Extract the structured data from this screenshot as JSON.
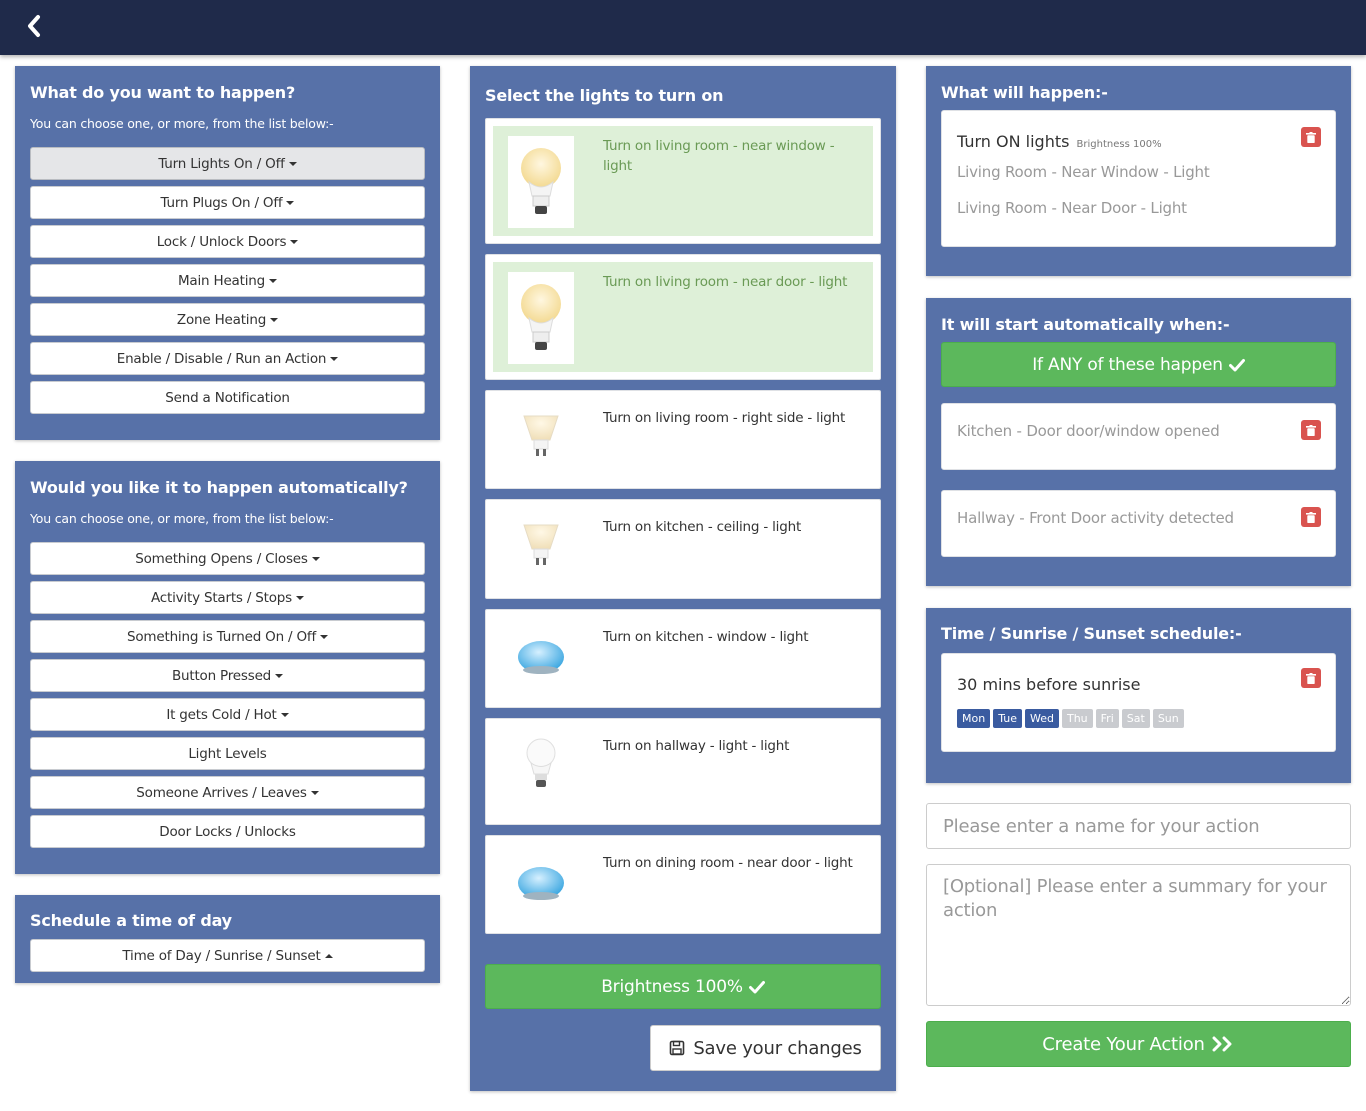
{
  "left": {
    "what": {
      "title": "What do you want to happen?",
      "subtitle": "You can choose one, or more, from the list below:-",
      "items": [
        {
          "label": "Turn Lights On / Off"
        },
        {
          "label": "Turn Plugs On / Off"
        },
        {
          "label": "Lock / Unlock Doors"
        },
        {
          "label": "Main Heating"
        },
        {
          "label": "Zone Heating"
        },
        {
          "label": "Enable / Disable / Run an Action"
        },
        {
          "label": "Send a Notification"
        }
      ]
    },
    "auto": {
      "title": "Would you like it to happen automatically?",
      "subtitle": "You can choose one, or more, from the list below:-",
      "items": [
        {
          "label": "Something Opens / Closes"
        },
        {
          "label": "Activity Starts / Stops"
        },
        {
          "label": "Something is Turned On / Off"
        },
        {
          "label": "Button Pressed"
        },
        {
          "label": "It gets Cold / Hot"
        },
        {
          "label": "Light Levels"
        },
        {
          "label": "Someone Arrives / Leaves"
        },
        {
          "label": "Door Locks / Unlocks"
        }
      ]
    },
    "schedule": {
      "title": "Schedule a time of day",
      "items": [
        {
          "label": "Time of Day / Sunrise / Sunset"
        }
      ]
    }
  },
  "middle": {
    "title": "Select the lights to turn on",
    "lights": [
      {
        "label": "Turn on living room - near window - light",
        "selected": true,
        "icon": "bulb-a19-icon"
      },
      {
        "label": "Turn on living room - near door - light",
        "selected": true,
        "icon": "bulb-a19-icon"
      },
      {
        "label": "Turn on living room - right side - light",
        "selected": false,
        "icon": "spot-bulb-icon"
      },
      {
        "label": "Turn on kitchen - ceiling - light",
        "selected": false,
        "icon": "spot-bulb-icon"
      },
      {
        "label": "Turn on kitchen - window - light",
        "selected": false,
        "icon": "bloom-lamp-icon"
      },
      {
        "label": "Turn on hallway - light - light",
        "selected": false,
        "icon": "white-bulb-icon"
      },
      {
        "label": "Turn on dining room - near door - light",
        "selected": false,
        "icon": "bloom-lamp-icon"
      }
    ],
    "brightness_label": "Brightness 100%",
    "save_label": "Save your changes"
  },
  "right": {
    "what_will": {
      "title": "What will happen:-",
      "heading": "Turn ON lights",
      "brightness": "Brightness 100%",
      "items": [
        "Living Room - Near Window - Light",
        "Living Room - Near Door - Light"
      ]
    },
    "start": {
      "title": "It will start automatically when:-",
      "any_label": "If ANY of these happen",
      "triggers": [
        "Kitchen - Door door/window opened",
        "Hallway - Front Door activity detected"
      ]
    },
    "schedule": {
      "title": "Time / Sunrise / Sunset schedule:-",
      "entry": "30 mins before sunrise",
      "days": [
        {
          "label": "Mon",
          "on": true
        },
        {
          "label": "Tue",
          "on": true
        },
        {
          "label": "Wed",
          "on": true
        },
        {
          "label": "Thu",
          "on": false
        },
        {
          "label": "Fri",
          "on": false
        },
        {
          "label": "Sat",
          "on": false
        },
        {
          "label": "Sun",
          "on": false
        }
      ]
    },
    "name_placeholder": "Please enter a name for your action",
    "summary_placeholder": "[Optional] Please enter a summary for your action",
    "create_label": "Create Your Action"
  },
  "colors": {
    "topbar": "#1f2a4a",
    "panel": "#5771a8",
    "success": "#5cb85c",
    "selected_bg": "#def0d8",
    "danger": "#d9534f",
    "day_on": "#3a5ba0",
    "day_off": "#c9cbcf"
  }
}
